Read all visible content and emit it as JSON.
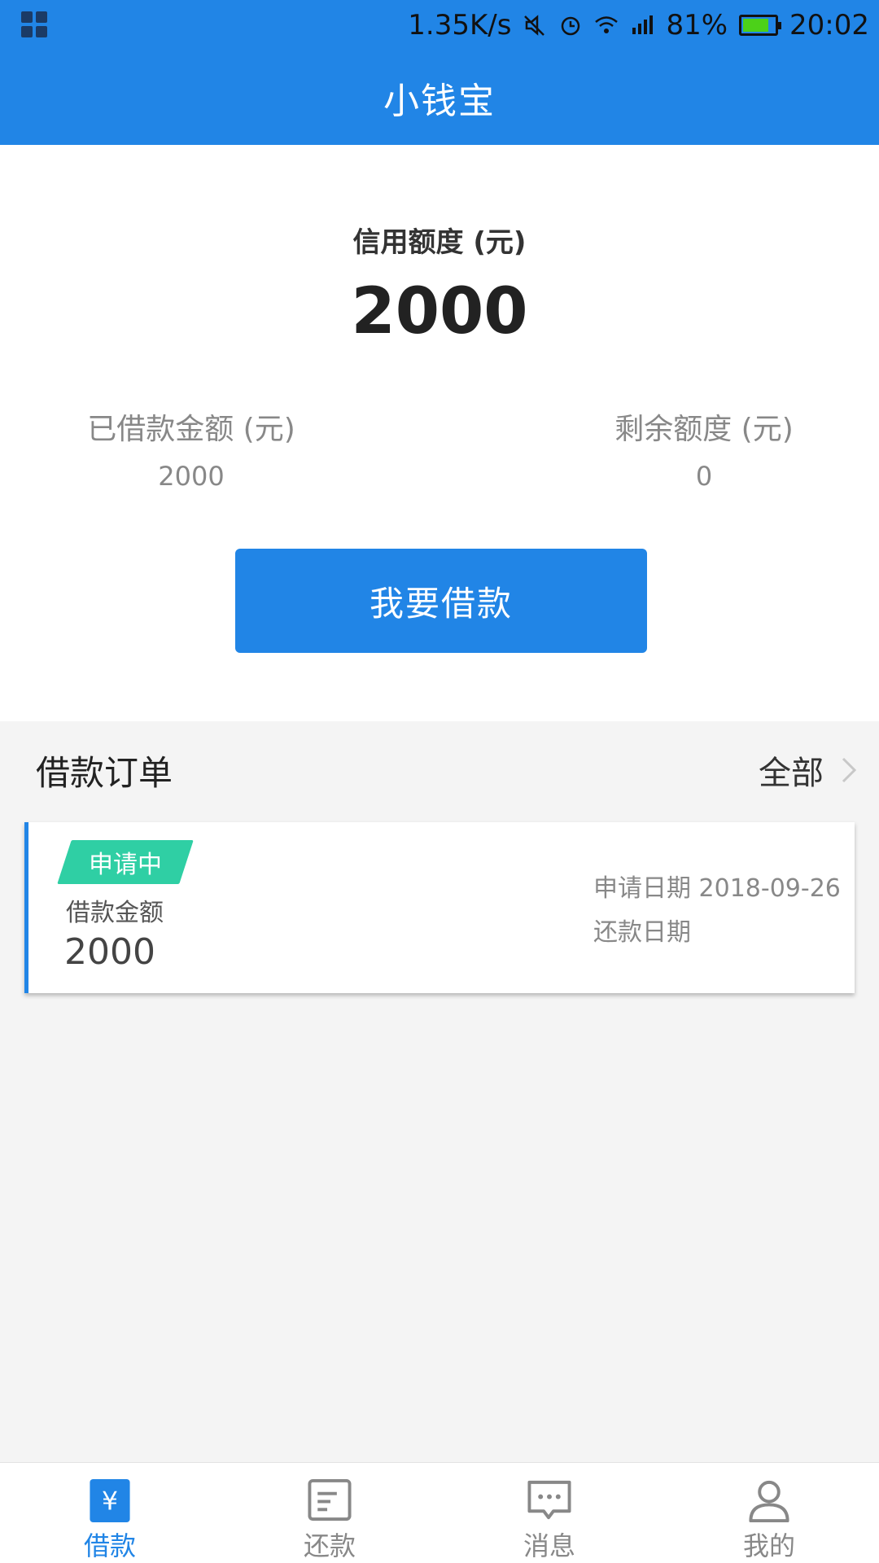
{
  "status_bar": {
    "speed": "1.35K/s",
    "battery_percent": "81%",
    "time": "20:02",
    "battery_level": 0.81,
    "icons": [
      "apps-grid-icon",
      "mute-icon",
      "alarm-icon",
      "wifi-icon",
      "signal-icon",
      "battery-icon"
    ]
  },
  "app_bar": {
    "title": "小钱宝"
  },
  "credit": {
    "label": "信用额度 (元)",
    "amount": "2000",
    "borrowed_label": "已借款金额 (元)",
    "borrowed_value": "2000",
    "remaining_label": "剩余额度 (元)",
    "remaining_value": "0",
    "borrow_button": "我要借款"
  },
  "orders": {
    "title": "借款订单",
    "view_all": "全部",
    "items": [
      {
        "status": "申请中",
        "amount_label": "借款金额",
        "amount": "2000",
        "apply_date": "申请日期 2018-09-26",
        "repay_date": "还款日期"
      }
    ]
  },
  "bottom_nav": {
    "items": [
      {
        "label": "借款",
        "icon": "yuan-icon",
        "active": true
      },
      {
        "label": "还款",
        "icon": "list-icon",
        "active": false
      },
      {
        "label": "消息",
        "icon": "message-icon",
        "active": false
      },
      {
        "label": "我的",
        "icon": "user-icon",
        "active": false
      }
    ]
  },
  "colors": {
    "primary": "#2185e6",
    "tag_green": "#2fcfa4",
    "background": "#f4f4f4"
  }
}
